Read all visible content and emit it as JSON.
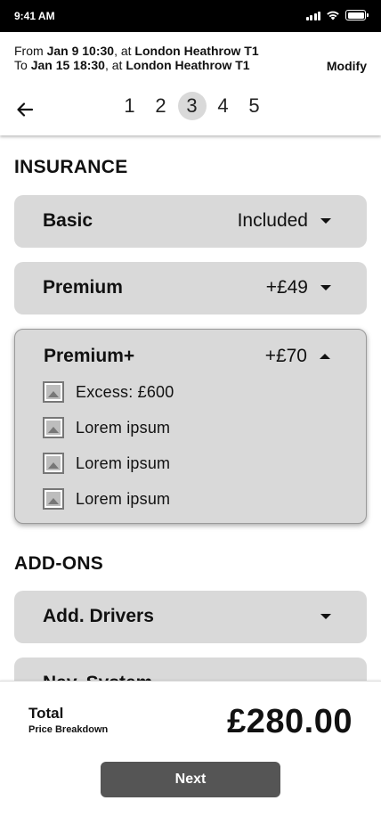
{
  "status_bar": {
    "time": "9:41 AM"
  },
  "trip": {
    "from_prefix": "From ",
    "from_date": "Jan 9 10:30",
    "from_sep": ", at ",
    "from_location": "London Heathrow T1",
    "to_prefix": "To ",
    "to_date": "Jan 15 18:30",
    "to_sep": ", at ",
    "to_location": "London Heathrow T1",
    "modify_label": "Modify"
  },
  "stepper": {
    "steps": [
      "1",
      "2",
      "3",
      "4",
      "5"
    ],
    "active_step": "3"
  },
  "insurance": {
    "title": "INSURANCE",
    "options": [
      {
        "name": "Basic",
        "price": "Included",
        "expanded": false
      },
      {
        "name": "Premium",
        "price": "+£49",
        "expanded": false
      },
      {
        "name": "Premium+",
        "price": "+£70",
        "expanded": true,
        "features": [
          "Excess: £600",
          "Lorem ipsum",
          "Lorem ipsum",
          "Lorem ipsum"
        ]
      }
    ]
  },
  "addons": {
    "title": "ADD-ONS",
    "options": [
      {
        "name": "Add. Drivers",
        "expanded": false
      },
      {
        "name": "Nav. System",
        "expanded": false
      }
    ]
  },
  "footer": {
    "total_label": "Total",
    "breakdown_label": "Price Breakdown",
    "total_amount": "£280.00",
    "next_label": "Next"
  },
  "colors": {
    "card_bg": "#d9d9d9",
    "button_bg": "#555555",
    "status_bar_bg": "#000000"
  }
}
